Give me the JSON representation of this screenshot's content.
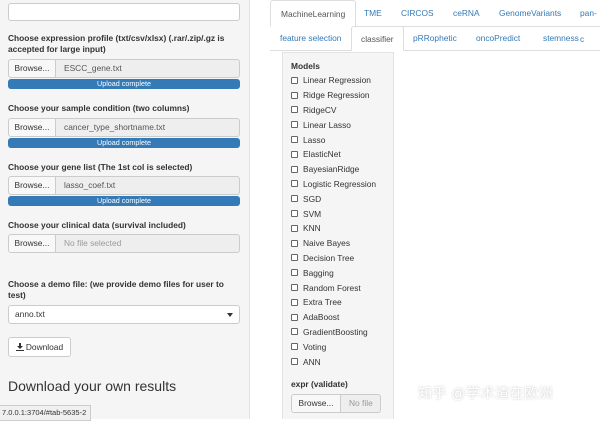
{
  "sidebar": {
    "expression": {
      "label": "Choose expression profile (txt/csv/xlsx) (.rar/.zip/.gz is accepted for large input)",
      "browse": "Browse...",
      "file": "ESCC_gene.txt",
      "progress": "Upload complete"
    },
    "condition": {
      "label": "Choose your sample condition (two columns)",
      "browse": "Browse...",
      "file": "cancer_type_shortname.txt",
      "progress": "Upload complete"
    },
    "genelist": {
      "label": "Choose your gene list (The 1st col is selected)",
      "browse": "Browse...",
      "file": "lasso_coef.txt",
      "progress": "Upload complete"
    },
    "clinical": {
      "label": "Choose your clinical data (survival included)",
      "browse": "Browse...",
      "placeholder": "No file selected"
    },
    "demo": {
      "label": "Choose a demo file: (we provide demo files for user to test)",
      "selected": "anno.txt"
    },
    "download_label": "Download",
    "heading": "Download your own results"
  },
  "statusbar": "7.0.0.1:3704/#tab-5635-2",
  "tabs_top": [
    "MachineLearning",
    "TME",
    "CIRCOS",
    "ceRNA",
    "GenomeVariants",
    "pan-c"
  ],
  "tabs_sub": [
    "feature selection",
    "classifier",
    "pRRophetic",
    "oncoPredict",
    "stemness"
  ],
  "models": {
    "label": "Models",
    "options": [
      "Linear Regression",
      "Ridge Regression",
      "RidgeCV",
      "Linear Lasso",
      "Lasso",
      "ElasticNet",
      "BayesianRidge",
      "Logistic Regression",
      "SGD",
      "SVM",
      "KNN",
      "Naive Bayes",
      "Decision Tree",
      "Bagging",
      "Random Forest",
      "Extra Tree",
      "AdaBoost",
      "GradientBoosting",
      "Voting",
      "ANN"
    ]
  },
  "expr": {
    "label": "expr (validate)",
    "browse": "Browse...",
    "placeholder": "No file"
  },
  "watermark": "知乎 @学术渣在欧洲",
  "colors": {
    "accent": "#337ab7",
    "sidebar_bg": "#f5f5f5"
  }
}
